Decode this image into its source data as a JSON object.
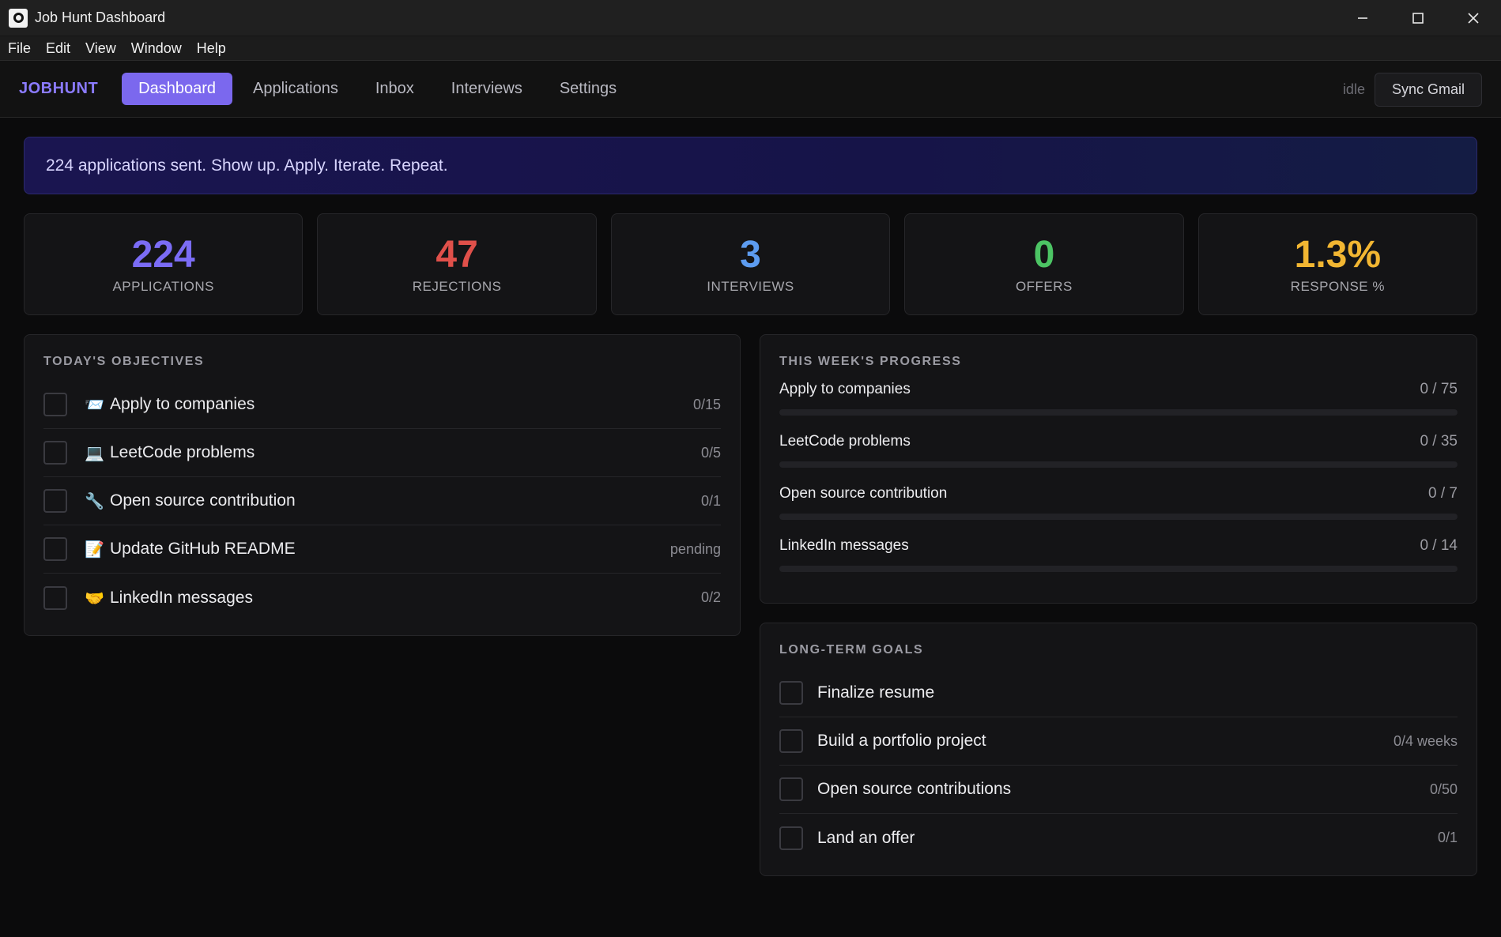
{
  "window": {
    "title": "Job Hunt Dashboard"
  },
  "menu": [
    "File",
    "Edit",
    "View",
    "Window",
    "Help"
  ],
  "nav": {
    "brand": "JOBHUNT",
    "tabs": [
      "Dashboard",
      "Applications",
      "Inbox",
      "Interviews",
      "Settings"
    ],
    "active_tab": "Dashboard",
    "sync_status": "idle",
    "sync_label": "Sync Gmail"
  },
  "banner": "224 applications sent. Show up. Apply. Iterate. Repeat.",
  "stats": [
    {
      "value": "224",
      "label": "APPLICATIONS",
      "color": "#7b6cf6"
    },
    {
      "value": "47",
      "label": "REJECTIONS",
      "color": "#e0504a"
    },
    {
      "value": "3",
      "label": "INTERVIEWS",
      "color": "#5d9cf0"
    },
    {
      "value": "0",
      "label": "OFFERS",
      "color": "#4cc464"
    },
    {
      "value": "1.3%",
      "label": "RESPONSE %",
      "color": "#f2b632"
    }
  ],
  "today": {
    "title": "TODAY'S OBJECTIVES",
    "items": [
      {
        "icon": "📨",
        "icon_name": "envelope-icon",
        "label": "Apply to companies",
        "count": "0/15"
      },
      {
        "icon": "💻",
        "icon_name": "laptop-icon",
        "label": "LeetCode problems",
        "count": "0/5"
      },
      {
        "icon": "🔧",
        "icon_name": "wrench-icon",
        "label": "Open source contribution",
        "count": "0/1"
      },
      {
        "icon": "📝",
        "icon_name": "memo-icon",
        "label": "Update GitHub README",
        "count": "pending"
      },
      {
        "icon": "🤝",
        "icon_name": "handshake-icon",
        "label": "LinkedIn messages",
        "count": "0/2"
      }
    ]
  },
  "week": {
    "title": "THIS WEEK'S PROGRESS",
    "items": [
      {
        "label": "Apply to companies",
        "count": "0 / 75",
        "progress": 0
      },
      {
        "label": "LeetCode problems",
        "count": "0 / 35",
        "progress": 0
      },
      {
        "label": "Open source contribution",
        "count": "0 / 7",
        "progress": 0
      },
      {
        "label": "LinkedIn messages",
        "count": "0 / 14",
        "progress": 0
      }
    ]
  },
  "goals": {
    "title": "LONG-TERM GOALS",
    "items": [
      {
        "label": "Finalize resume",
        "count": ""
      },
      {
        "label": "Build a portfolio project",
        "count": "0/4 weeks"
      },
      {
        "label": "Open source contributions",
        "count": "0/50"
      },
      {
        "label": "Land an offer",
        "count": "0/1"
      }
    ]
  },
  "accent_color": "#7b68ee"
}
